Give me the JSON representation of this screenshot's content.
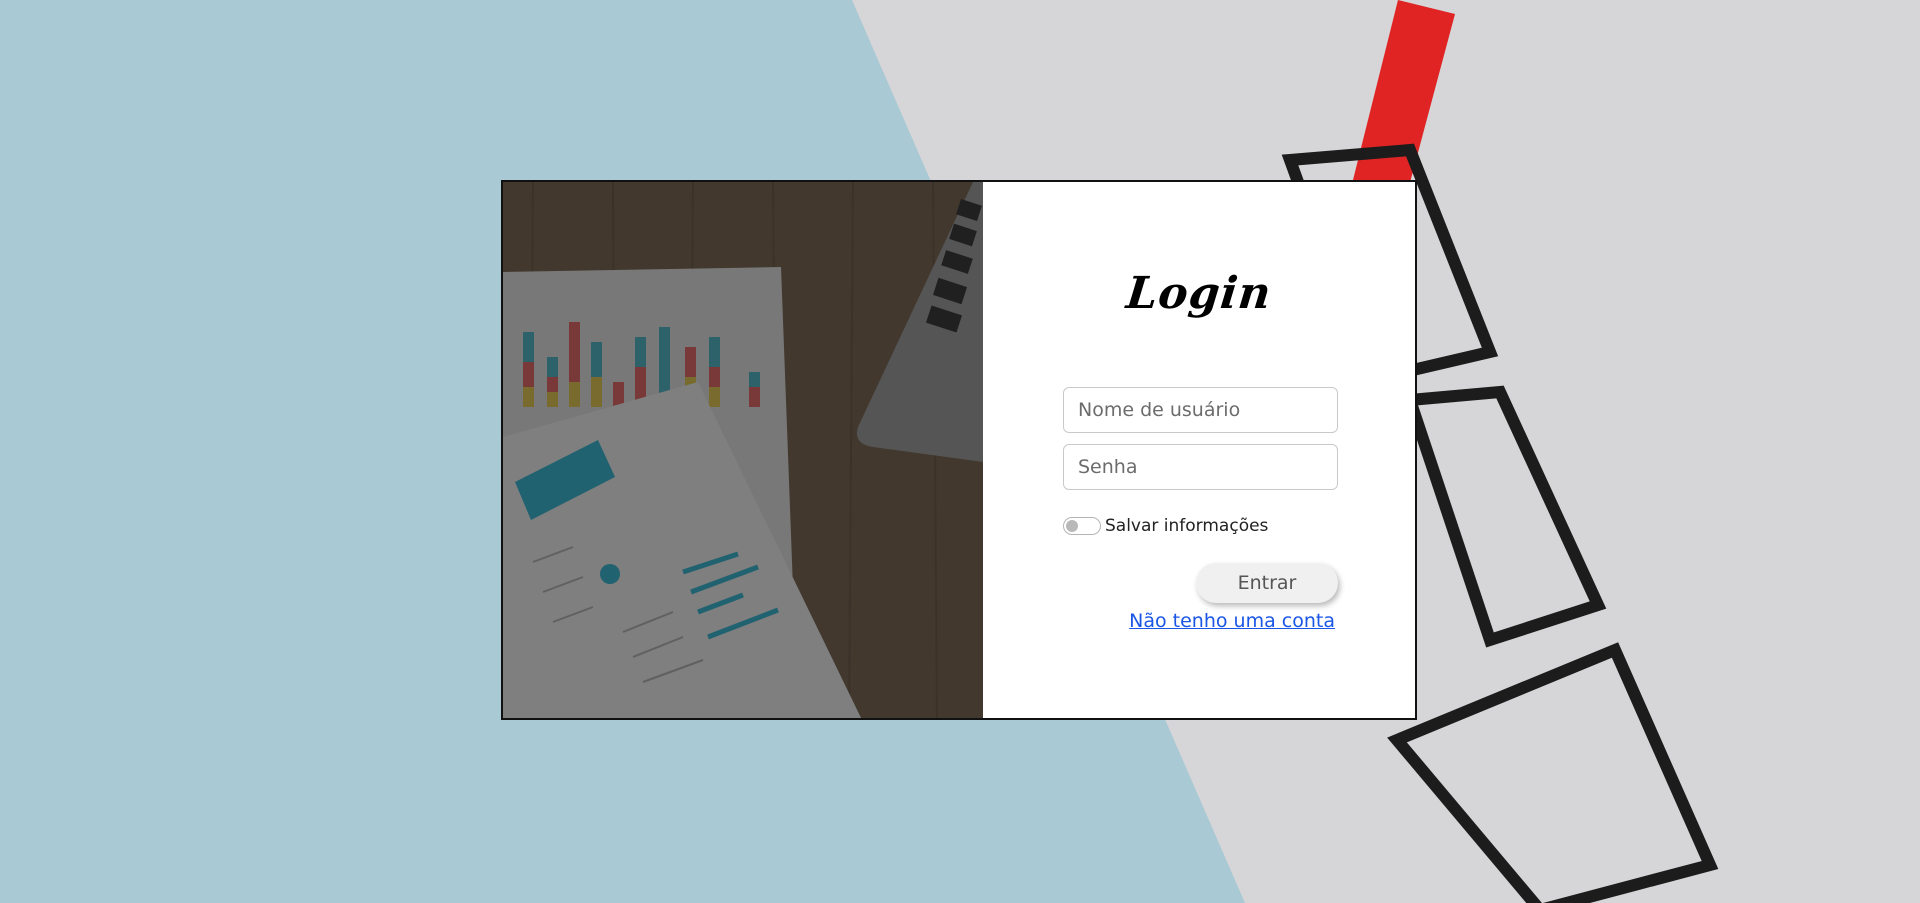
{
  "login": {
    "title": "Login",
    "username_placeholder": "Nome de usuário",
    "password_placeholder": "Senha",
    "save_label": "Salvar informações",
    "enter_label": "Entrar",
    "signup_link": "Não tenho uma conta"
  },
  "colors": {
    "background_blue": "#a9c9d4",
    "background_paper": "#d8d8d8",
    "link": "#1a56e6",
    "accent_red": "#e02424"
  }
}
